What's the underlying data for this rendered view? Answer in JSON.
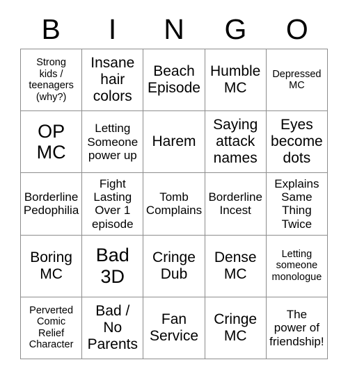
{
  "card": {
    "header_letters": [
      "B",
      "I",
      "N",
      "G",
      "O"
    ],
    "border_color": "#8d8d8d",
    "text_color": "#000000",
    "background_color": "#ffffff",
    "columns": 5,
    "rows": 5,
    "cells": [
      {
        "text": "Strong\nkids /\nteenagers\n(why?)",
        "size": "s"
      },
      {
        "text": "Insane\nhair\ncolors",
        "size": "l"
      },
      {
        "text": "Beach\nEpisode",
        "size": "l"
      },
      {
        "text": "Humble\nMC",
        "size": "l"
      },
      {
        "text": "Depressed\nMC",
        "size": "s"
      },
      {
        "text": "OP\nMC",
        "size": "xl"
      },
      {
        "text": "Letting\nSomeone\npower up",
        "size": "m"
      },
      {
        "text": "Harem",
        "size": "l"
      },
      {
        "text": "Saying\nattack\nnames",
        "size": "l"
      },
      {
        "text": "Eyes\nbecome\ndots",
        "size": "l"
      },
      {
        "text": "Borderline\nPedophilia",
        "size": "m"
      },
      {
        "text": "Fight\nLasting\nOver 1\nepisode",
        "size": "m"
      },
      {
        "text": "Tomb\nComplains",
        "size": "m"
      },
      {
        "text": "Borderline\nIncest",
        "size": "m"
      },
      {
        "text": "Explains\nSame\nThing\nTwice",
        "size": "m"
      },
      {
        "text": "Boring\nMC",
        "size": "l"
      },
      {
        "text": "Bad\n3D",
        "size": "xl"
      },
      {
        "text": "Cringe\nDub",
        "size": "l"
      },
      {
        "text": "Dense\nMC",
        "size": "l"
      },
      {
        "text": "Letting\nsomeone\nmonologue",
        "size": "s"
      },
      {
        "text": "Perverted\nComic\nRelief\nCharacter",
        "size": "s"
      },
      {
        "text": "Bad /\nNo\nParents",
        "size": "l"
      },
      {
        "text": "Fan\nService",
        "size": "l"
      },
      {
        "text": "Cringe\nMC",
        "size": "l"
      },
      {
        "text": "The\npower of\nfriendship!",
        "size": "m"
      }
    ]
  }
}
